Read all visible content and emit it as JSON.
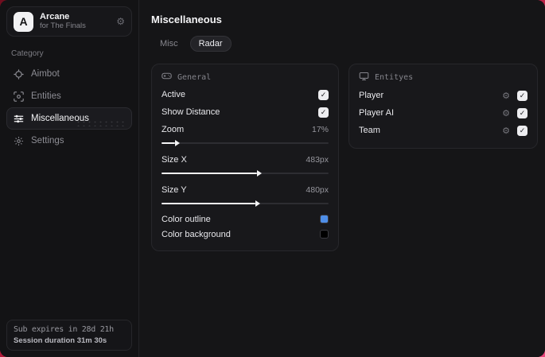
{
  "sidebar": {
    "header": {
      "logo": "A",
      "title": "Arcane",
      "subtitle": "for The Finals",
      "gear": "⚙"
    },
    "category_label": "Category",
    "items": [
      {
        "label": "Aimbot",
        "active": false
      },
      {
        "label": "Entities",
        "active": false
      },
      {
        "label": "Miscellaneous",
        "active": true
      },
      {
        "label": "Settings",
        "active": false
      }
    ],
    "footer": {
      "line1": "Sub expires in 28d 21h",
      "line2": "Session duration 31m 30s"
    }
  },
  "main": {
    "title": "Miscellaneous",
    "tabs": [
      {
        "label": "Misc",
        "active": false
      },
      {
        "label": "Radar",
        "active": true
      }
    ],
    "panels": {
      "general": {
        "title": "General",
        "toggles": [
          {
            "label": "Active",
            "checked": true
          },
          {
            "label": "Show Distance",
            "checked": true
          }
        ],
        "sliders": [
          {
            "label": "Zoom",
            "value": "17%",
            "percent": 8
          },
          {
            "label": "Size X",
            "value": "483px",
            "percent": 57
          },
          {
            "label": "Size Y",
            "value": "480px",
            "percent": 56
          }
        ],
        "colors": [
          {
            "label": "Color outline",
            "color": "#4e8ee8"
          },
          {
            "label": "Color background",
            "color": "#000000"
          }
        ]
      },
      "entities": {
        "title": "Entityes",
        "rows": [
          {
            "label": "Player",
            "checked": true
          },
          {
            "label": "Player AI",
            "checked": true
          },
          {
            "label": "Team",
            "checked": true
          }
        ]
      }
    }
  },
  "glyphs": {
    "gear": "⚙",
    "check": "✓"
  }
}
